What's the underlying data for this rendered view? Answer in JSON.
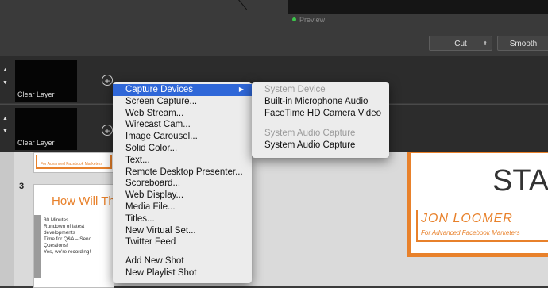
{
  "preview": {
    "label": "Preview"
  },
  "transition": {
    "cut_label": "Cut",
    "smooth_label": "Smooth"
  },
  "layers": [
    {
      "label": "Clear Layer"
    },
    {
      "label": "Clear Layer"
    }
  ],
  "context_menu": {
    "items": [
      {
        "label": "Capture Devices",
        "has_submenu": true,
        "active": true
      },
      {
        "label": "Screen Capture..."
      },
      {
        "label": "Web Stream..."
      },
      {
        "label": "Wirecast Cam..."
      },
      {
        "label": "Image Carousel..."
      },
      {
        "label": "Solid Color..."
      },
      {
        "label": "Text..."
      },
      {
        "label": "Remote Desktop Presenter..."
      },
      {
        "label": "Scoreboard..."
      },
      {
        "label": "Web Display..."
      },
      {
        "label": "Media File..."
      },
      {
        "label": "Titles..."
      },
      {
        "label": "New Virtual Set..."
      },
      {
        "label": "Twitter Feed"
      }
    ],
    "footer_items": [
      {
        "label": "Add New Shot"
      },
      {
        "label": "New Playlist Shot"
      }
    ]
  },
  "submenu": {
    "system_device_header": "System Device",
    "system_device_items": [
      "Built-in Microphone Audio",
      "FaceTime HD Camera Video"
    ],
    "system_audio_header": "System Audio Capture",
    "system_audio_items": [
      "System Audio Capture"
    ]
  },
  "background_doc": {
    "slide_number": "3",
    "slide_title": "How Will Thi",
    "bullets": [
      "30 Minutes",
      "Rundown of latest developments",
      "Time for Q&A – Send Questions!",
      "Yes, we're recording!"
    ],
    "big_title": "STA",
    "logo_name": "JON LOOMER",
    "logo_sub": "For Advanced Facebook Marketers",
    "thumb_logo_sub": "For Advanced Facebook Marketers"
  },
  "colors": {
    "accent": "#2f67d8",
    "brand_orange": "#e8812b",
    "live_dot": "#3cc44a"
  }
}
